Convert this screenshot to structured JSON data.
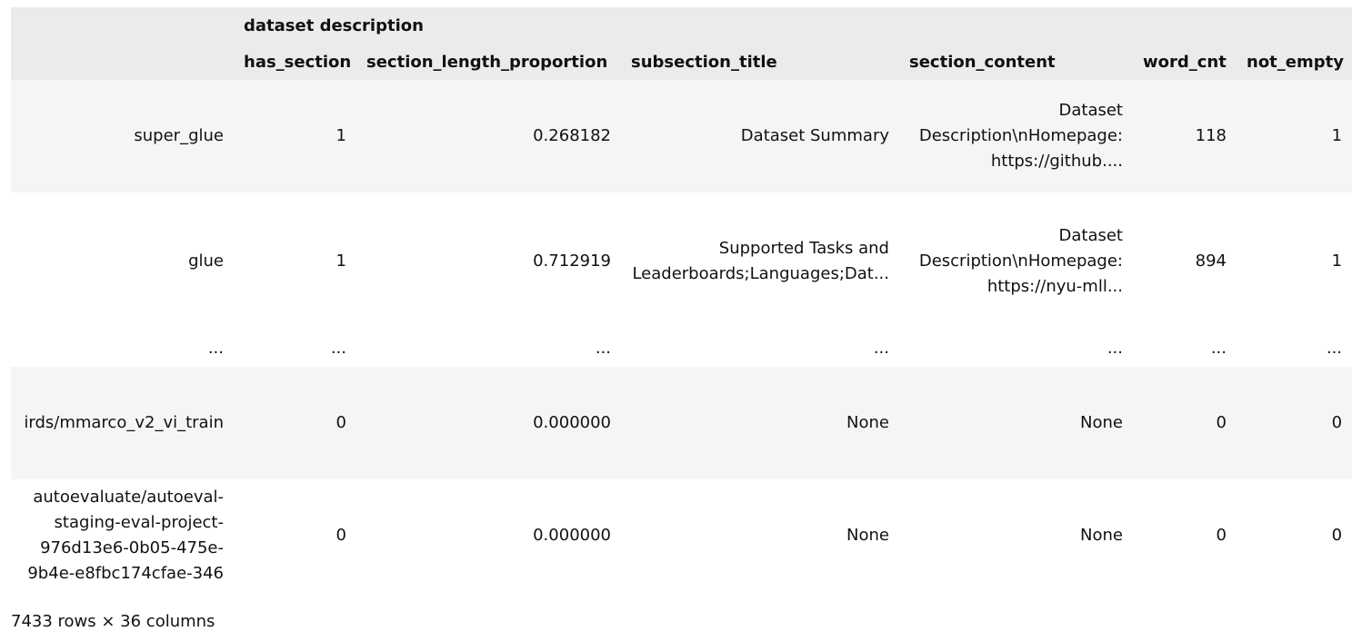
{
  "table": {
    "group_header": "dataset description",
    "columns": [
      "has_section",
      "section_length_proportion",
      "subsection_title",
      "section_content",
      "word_cnt",
      "not_empty"
    ],
    "rows": [
      {
        "index": "super_glue",
        "has_section": "1",
        "section_length_proportion": "0.268182",
        "subsection_title": "Dataset Summary",
        "section_content": "Dataset Description\\nHomepage: https://github....",
        "word_cnt": "118",
        "not_empty": "1"
      },
      {
        "index": "glue",
        "has_section": "1",
        "section_length_proportion": "0.712919",
        "subsection_title": "Supported Tasks and Leaderboards;Languages;Dat...",
        "section_content": "Dataset Description\\nHomepage: https://nyu-mll...",
        "word_cnt": "894",
        "not_empty": "1"
      },
      {
        "index": "...",
        "has_section": "...",
        "section_length_proportion": "...",
        "subsection_title": "...",
        "section_content": "...",
        "word_cnt": "...",
        "not_empty": "..."
      },
      {
        "index": "irds/mmarco_v2_vi_train",
        "has_section": "0",
        "section_length_proportion": "0.000000",
        "subsection_title": "None",
        "section_content": "None",
        "word_cnt": "0",
        "not_empty": "0"
      },
      {
        "index": "autoevaluate/autoeval-staging-eval-project-976d13e6-0b05-475e-9b4e-e8fbc174cfae-346",
        "has_section": "0",
        "section_length_proportion": "0.000000",
        "subsection_title": "None",
        "section_content": "None",
        "word_cnt": "0",
        "not_empty": "0"
      }
    ],
    "footer": "7433 rows × 36 columns"
  }
}
